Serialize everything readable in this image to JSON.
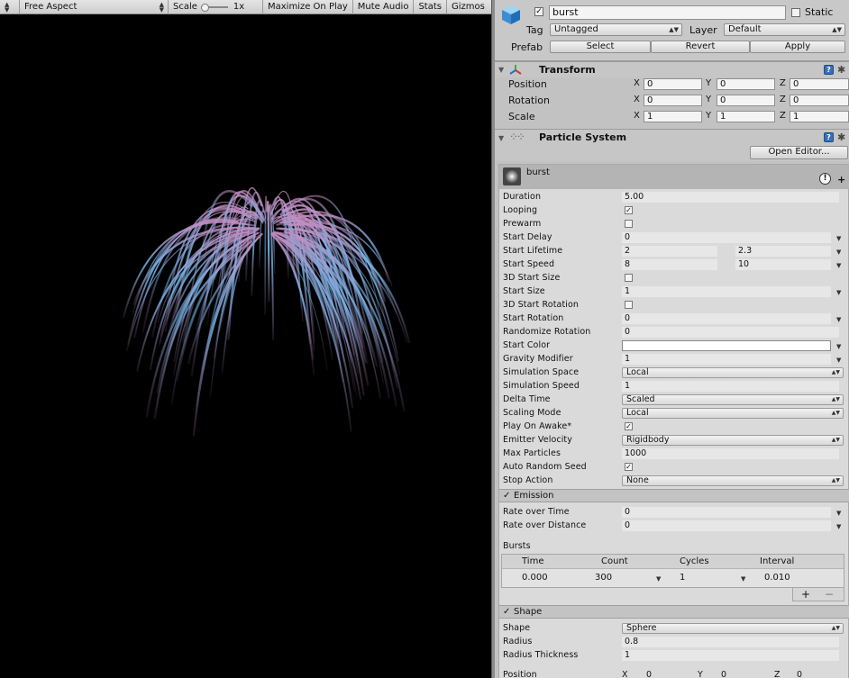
{
  "game_toolbar": {
    "aspect": "Free Aspect",
    "scale_label": "Scale",
    "scale_value": "1x",
    "maximize": "Maximize On Play",
    "mute": "Mute Audio",
    "stats": "Stats",
    "gizmos": "Gizmos"
  },
  "object": {
    "name": "burst",
    "active": true,
    "static_label": "Static",
    "static": false,
    "tag_label": "Tag",
    "tag_value": "Untagged",
    "layer_label": "Layer",
    "layer_value": "Default",
    "prefab_label": "Prefab",
    "select": "Select",
    "revert": "Revert",
    "apply": "Apply"
  },
  "transform": {
    "title": "Transform",
    "position_label": "Position",
    "rotation_label": "Rotation",
    "scale_label": "Scale",
    "x": "X",
    "y": "Y",
    "z": "Z",
    "position": [
      "0",
      "0",
      "0"
    ],
    "rotation": [
      "0",
      "0",
      "0"
    ],
    "scale": [
      "1",
      "1",
      "1"
    ]
  },
  "particle_system": {
    "title": "Particle System",
    "open_editor": "Open Editor...",
    "system_name": "burst",
    "main": {
      "duration_label": "Duration",
      "duration": "5.00",
      "looping_label": "Looping",
      "looping": true,
      "prewarm_label": "Prewarm",
      "prewarm": false,
      "start_delay_label": "Start Delay",
      "start_delay": "0",
      "start_lifetime_label": "Start Lifetime",
      "start_lifetime_min": "2",
      "start_lifetime_max": "2.3",
      "start_speed_label": "Start Speed",
      "start_speed_min": "8",
      "start_speed_max": "10",
      "start_size_3d_label": "3D Start Size",
      "start_size_3d": false,
      "start_size_label": "Start Size",
      "start_size": "1",
      "start_rotation_3d_label": "3D Start Rotation",
      "start_rotation_3d": false,
      "start_rotation_label": "Start Rotation",
      "start_rotation": "0",
      "randomize_rotation_label": "Randomize Rotation",
      "randomize_rotation": "0",
      "start_color_label": "Start Color",
      "start_color": "#ffffff",
      "gravity_label": "Gravity Modifier",
      "gravity": "1",
      "sim_space_label": "Simulation Space",
      "sim_space": "Local",
      "sim_speed_label": "Simulation Speed",
      "sim_speed": "1",
      "delta_time_label": "Delta Time",
      "delta_time": "Scaled",
      "scaling_mode_label": "Scaling Mode",
      "scaling_mode": "Local",
      "play_on_awake_label": "Play On Awake*",
      "play_on_awake": true,
      "emitter_velocity_label": "Emitter Velocity",
      "emitter_velocity": "Rigidbody",
      "max_particles_label": "Max Particles",
      "max_particles": "1000",
      "auto_seed_label": "Auto Random Seed",
      "auto_seed": true,
      "stop_action_label": "Stop Action",
      "stop_action": "None"
    },
    "emission": {
      "title": "Emission",
      "enabled": true,
      "rate_time_label": "Rate over Time",
      "rate_time": "0",
      "rate_distance_label": "Rate over Distance",
      "rate_distance": "0",
      "bursts_label": "Bursts",
      "columns": [
        "Time",
        "Count",
        "Cycles",
        "Interval"
      ],
      "burst_row": [
        "0.000",
        "300",
        "1",
        "0.010"
      ],
      "add": "+",
      "remove": "−"
    },
    "shape": {
      "title": "Shape",
      "enabled": true,
      "shape_label": "Shape",
      "shape": "Sphere",
      "radius_label": "Radius",
      "radius": "0.8",
      "thickness_label": "Radius Thickness",
      "thickness": "1",
      "position_label": "Position",
      "pos_x": "0",
      "pos_y": "0",
      "pos_z": "0"
    }
  },
  "colors": {
    "game_background": "#000000",
    "inspector_background": "#c2c2c2",
    "firework_blue": "#6fb4e6",
    "firework_pink": "#c58cbf"
  }
}
